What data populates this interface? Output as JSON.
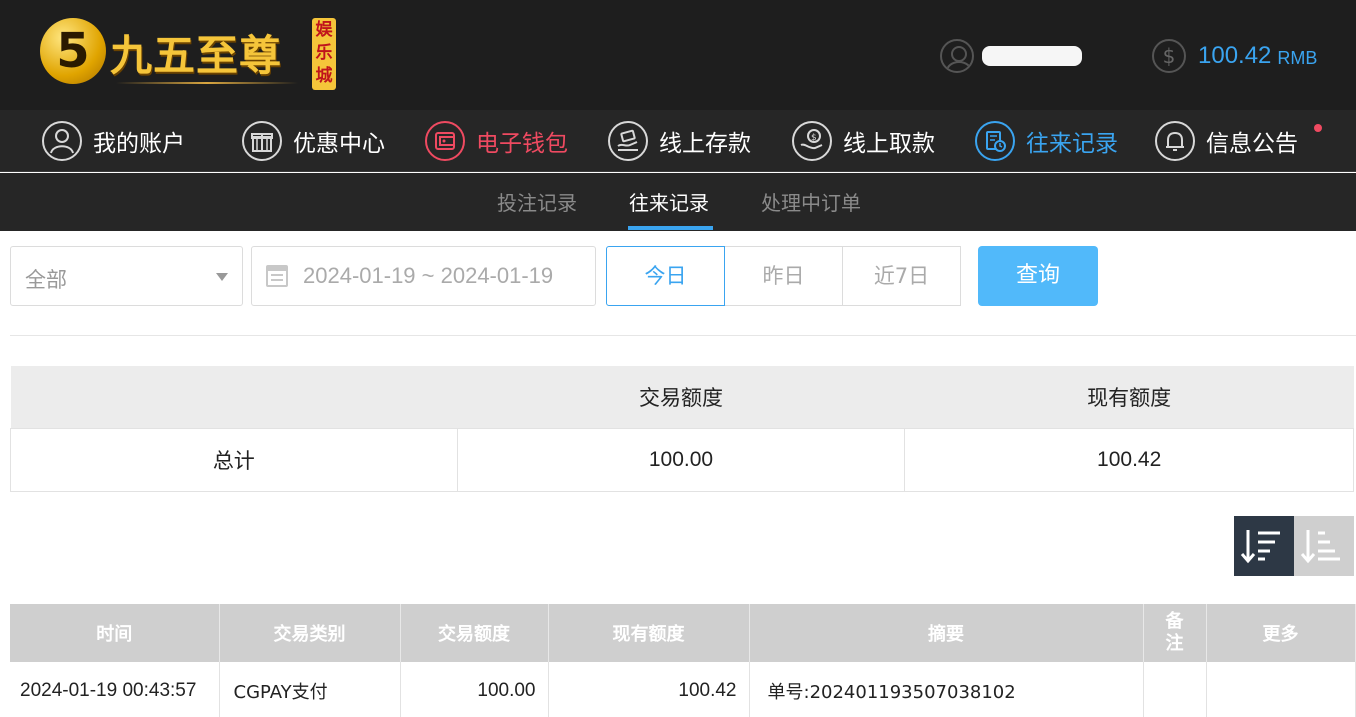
{
  "header": {
    "logo_mark": "5",
    "logo_title": "九五至尊",
    "logo_badge": "娱乐城",
    "username_masked": "",
    "balance": "100.42",
    "currency": "RMB"
  },
  "main_nav": [
    {
      "label": "我的账户",
      "icon": "user-icon"
    },
    {
      "label": "优惠中心",
      "icon": "gift-icon"
    },
    {
      "label": "电子钱包",
      "icon": "wallet-icon",
      "state": "active-red"
    },
    {
      "label": "线上存款",
      "icon": "deposit-icon"
    },
    {
      "label": "线上取款",
      "icon": "withdraw-icon"
    },
    {
      "label": "往来记录",
      "icon": "records-icon",
      "state": "active-blue"
    },
    {
      "label": "信息公告",
      "icon": "bell-icon",
      "has_notification": true
    }
  ],
  "sub_nav": {
    "items": [
      "投注记录",
      "往来记录",
      "处理中订单"
    ],
    "active": "往来记录"
  },
  "filters": {
    "type_select": "全部",
    "date_range": "2024-01-19 ~ 2024-01-19",
    "quick_ranges": [
      "今日",
      "昨日",
      "近7日"
    ],
    "active_range": "今日",
    "search_label": "查询"
  },
  "summary": {
    "headers": [
      "",
      "交易额度",
      "现有额度"
    ],
    "row": [
      "总计",
      "100.00",
      "100.42"
    ]
  },
  "detail": {
    "headers": [
      "时间",
      "交易类别",
      "交易额度",
      "现有额度",
      "摘要",
      "备注",
      "更多"
    ],
    "rows": [
      [
        "2024-01-19 00:43:57",
        "CGPAY支付",
        "100.00",
        "100.42",
        "单号:202401193507038102",
        "",
        ""
      ]
    ]
  },
  "colors": {
    "accent_blue": "#3aa4f0",
    "accent_red": "#ef4a61",
    "header_bg": "#1e1e1e",
    "logo_gold": "#f5c53a"
  }
}
